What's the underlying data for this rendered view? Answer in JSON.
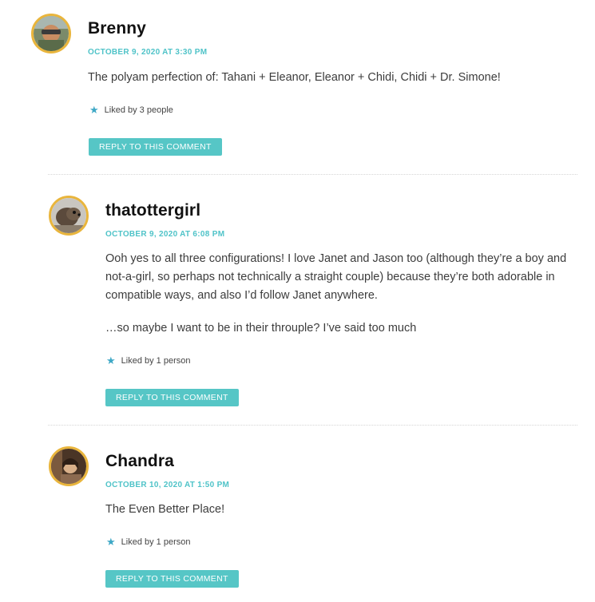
{
  "comments": [
    {
      "author": "Brenny",
      "date": "OCTOBER 9, 2020 AT 3:30 PM",
      "paragraphs": [
        "The polyam perfection of: Tahani + Eleanor, Eleanor + Chidi, Chidi + Dr. Simone!"
      ],
      "likes": "Liked by 3 people",
      "reply_label": "REPLY TO THIS COMMENT"
    },
    {
      "author": "thatottergirl",
      "date": "OCTOBER 9, 2020 AT 6:08 PM",
      "paragraphs": [
        "Ooh yes to all three configurations! I love Janet and Jason too (although they’re a boy and not-a-girl, so perhaps not technically a straight couple) because they’re both adorable in compatible ways, and also I’d follow Janet anywhere.",
        "…so maybe I want to be in their throuple? I’ve said too much"
      ],
      "likes": "Liked by 1 person",
      "reply_label": "REPLY TO THIS COMMENT"
    },
    {
      "author": "Chandra",
      "date": "OCTOBER 10, 2020 AT 1:50 PM",
      "paragraphs": [
        "The Even Better Place!"
      ],
      "likes": "Liked by 1 person",
      "reply_label": "REPLY TO THIS COMMENT"
    }
  ],
  "colors": {
    "accent": "#4fc3c8",
    "reply_button": "#56c6c6",
    "avatar_border": "#e9b53c",
    "star": "#3ea8c6"
  },
  "icons": {
    "like": "star-icon"
  }
}
